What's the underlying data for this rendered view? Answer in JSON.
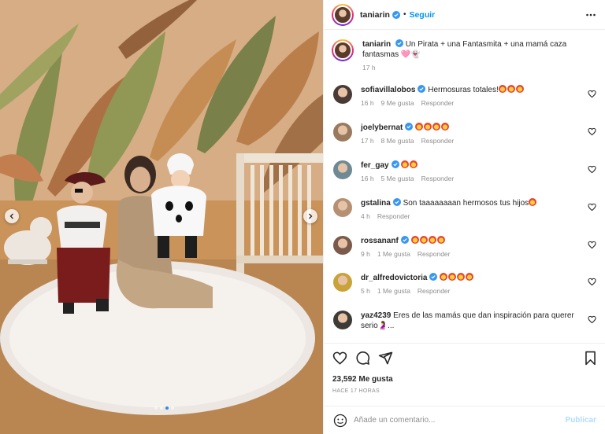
{
  "post": {
    "username": "taniarin",
    "follow_label": "Seguir",
    "separator": "•",
    "caption": "Un Pirata + una Fantasmita + una mamá caza fantasmas 🩷👻",
    "caption_time": "17 h",
    "likes": "23,592 Me gusta",
    "posted_ago": "HACE 17 HORAS"
  },
  "comments": [
    {
      "user": "sofiavillalobos",
      "verified": true,
      "text": "Hermosuras totales!",
      "emoji_count": 3,
      "time": "16 h",
      "likes": "9 Me gusta",
      "reply": "Responder",
      "avatar_color": "#4a3a36"
    },
    {
      "user": "joelybernat",
      "verified": true,
      "text": "",
      "emoji_count": 4,
      "time": "17 h",
      "likes": "8 Me gusta",
      "reply": "Responder",
      "avatar_color": "#9a7a5e"
    },
    {
      "user": "fer_gay",
      "verified": true,
      "text": "",
      "emoji_count": 2,
      "time": "16 h",
      "likes": "5 Me gusta",
      "reply": "Responder",
      "avatar_color": "#6f8a94"
    },
    {
      "user": "gstalina",
      "verified": true,
      "text": "Son taaaaaaaan hermosos tus hijos",
      "emoji_count": 1,
      "time": "4 h",
      "likes": "",
      "reply": "Responder",
      "avatar_color": "#b59072"
    },
    {
      "user": "rossananf",
      "verified": true,
      "text": "",
      "emoji_count": 4,
      "time": "9 h",
      "likes": "1 Me gusta",
      "reply": "Responder",
      "avatar_color": "#7a5a4a"
    },
    {
      "user": "dr_alfredovictoria",
      "verified": true,
      "text": "",
      "emoji_count": 4,
      "time": "5 h",
      "likes": "1 Me gusta",
      "reply": "Responder",
      "avatar_color": "#c9a23a"
    },
    {
      "user": "yaz4239",
      "verified": false,
      "text": "Eres de las mamás que dan inspiración para querer serio🤰...",
      "emoji_count": 0,
      "time": "",
      "likes": "",
      "reply": "",
      "avatar_color": "#3e3a36"
    }
  ],
  "add_comment": {
    "placeholder": "Añade un comentario...",
    "publish_label": "Publicar"
  },
  "icons": {
    "more": "more-horizontal-icon",
    "like": "heart-icon",
    "comment": "comment-icon",
    "share": "share-icon",
    "save": "bookmark-icon",
    "emoji": "emoji-icon",
    "prev": "chevron-left-icon",
    "next": "chevron-right-icon",
    "verified": "verified-badge-icon"
  },
  "colors": {
    "accent": "#0095f6",
    "verified": "#3897f0",
    "publish_disabled": "#b3dbff",
    "muted": "#8e8e8e"
  }
}
